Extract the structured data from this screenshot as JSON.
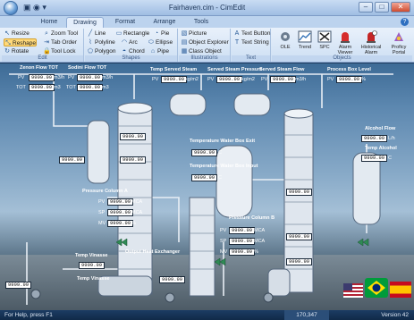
{
  "window": {
    "title": "Fairhaven.cim - CimEdit",
    "qat_glyphs": "▣ ◉ ▾",
    "btn_minimize": "–",
    "btn_maximize": "□",
    "btn_close": "✕"
  },
  "ribbon": {
    "tabs": [
      {
        "label": "Home"
      },
      {
        "label": "Drawing"
      },
      {
        "label": "Format"
      },
      {
        "label": "Arrange"
      },
      {
        "label": "Tools"
      }
    ],
    "help_glyph": "?",
    "edit_group": {
      "label": "Edit",
      "items": [
        {
          "label": "Resize",
          "icon": "resize-icon",
          "glyph": "↖"
        },
        {
          "label": "Zoom Tool",
          "icon": "zoom-icon",
          "glyph": "⌕"
        },
        {
          "label": "Reshape",
          "icon": "reshape-icon",
          "glyph": "⤡"
        },
        {
          "label": "Tab Order",
          "icon": "tab-order-icon",
          "glyph": "⇥"
        },
        {
          "label": "Rotate",
          "icon": "rotate-icon",
          "glyph": "↻"
        },
        {
          "label": "Tool Lock",
          "icon": "lock-icon",
          "glyph": "🔒"
        }
      ]
    },
    "shapes_group": {
      "label": "Shapes",
      "items": [
        {
          "label": "Line",
          "icon": "line-icon",
          "glyph": "╱"
        },
        {
          "label": "Rectangle",
          "icon": "rectangle-icon",
          "glyph": "▭"
        },
        {
          "label": "Pie",
          "icon": "pie-icon",
          "glyph": "◔"
        },
        {
          "label": "Polyline",
          "icon": "polyline-icon",
          "glyph": "⌇"
        },
        {
          "label": "Arc",
          "icon": "arc-icon",
          "glyph": "◠"
        },
        {
          "label": "Ellipse",
          "icon": "ellipse-icon",
          "glyph": "⬭"
        },
        {
          "label": "Polygon",
          "icon": "polygon-icon",
          "glyph": "⬠"
        },
        {
          "label": "Chord",
          "icon": "chord-icon",
          "glyph": "◓"
        },
        {
          "label": "Pipe",
          "icon": "pipe-icon",
          "glyph": "⌂"
        }
      ]
    },
    "illustrations_group": {
      "label": "Illustrations",
      "items": [
        {
          "label": "Picture",
          "icon": "picture-icon",
          "glyph": "▧"
        },
        {
          "label": "Object Explorer",
          "icon": "object-explorer-icon",
          "glyph": "▤"
        },
        {
          "label": "Class Object",
          "icon": "class-object-icon",
          "glyph": "▦"
        }
      ]
    },
    "text_group": {
      "label": "Text",
      "items": [
        {
          "label": "Text Button",
          "icon": "text-button-icon",
          "glyph": "A"
        },
        {
          "label": "Text String",
          "icon": "text-string-icon",
          "glyph": "T"
        }
      ]
    },
    "objects_group": {
      "label": "Objects",
      "buttons": [
        {
          "label": "OLE",
          "icon": "ole-icon"
        },
        {
          "label": "Trend",
          "icon": "trend-icon"
        },
        {
          "label": "SPC",
          "icon": "spc-icon"
        },
        {
          "label": "Alarm Viewer",
          "icon": "alarm-viewer-icon"
        },
        {
          "label": "Historical Alarm Viewer",
          "icon": "historical-alarm-icon"
        },
        {
          "label": "Proficy Portal",
          "icon": "proficy-portal-icon"
        }
      ]
    }
  },
  "canvas": {
    "top_panels": [
      {
        "title": "Zenon Flow TOT",
        "rows": [
          {
            "k": "PV",
            "v": "9999.99",
            "u": "m3/h"
          },
          {
            "k": "TOT",
            "v": "9999.99",
            "u": "m3"
          }
        ]
      },
      {
        "title": "Sodini Flow TOT",
        "rows": [
          {
            "k": "PV",
            "v": "9999.99",
            "u": "m3/h"
          },
          {
            "k": "TOT",
            "v": "9999.99",
            "u": "m3"
          }
        ]
      },
      {
        "title": "Temp Served Steam",
        "rows": [
          {
            "k": "PV",
            "v": "9999.99",
            "u": "kg/m2"
          }
        ]
      },
      {
        "title": "Served Steam Pressure",
        "rows": [
          {
            "k": "PV",
            "v": "9999.99",
            "u": "kg/m2"
          }
        ]
      },
      {
        "title": "Served Steam Flow",
        "rows": [
          {
            "k": "PV",
            "v": "9999.99",
            "u": "m3/h"
          }
        ]
      },
      {
        "title": "Process Box Level",
        "rows": [
          {
            "k": "PV",
            "v": "9999.99",
            "u": "%"
          }
        ]
      }
    ],
    "water_box": {
      "exit_label": "Temperature Water Box Exit",
      "exit_value": "9999.99",
      "inlet_label": "Temperature Water Box Input",
      "inlet_value": "9999.99",
      "unit": "C"
    },
    "pressure_a": {
      "title": "Pressure Column A",
      "rows": [
        {
          "k": "PV",
          "v": "9999.99",
          "u": "MCA"
        },
        {
          "k": "SP",
          "v": "9999.99",
          "u": "MCA"
        },
        {
          "k": "MV",
          "v": "9999.99",
          "u": "%"
        }
      ]
    },
    "pressure_b": {
      "title": "Pressure Column B",
      "rows": [
        {
          "k": "PV",
          "v": "9999.99",
          "u": "MCA"
        },
        {
          "k": "SP",
          "v": "9999.99",
          "u": "MCA"
        },
        {
          "k": "MV",
          "v": "9999.99",
          "u": "%"
        }
      ]
    },
    "alcohol": {
      "flow_label": "Alcohol Flow",
      "flow_value": "9999.99",
      "flow_unit": "L/h",
      "temp_label": "Temp Alcohol",
      "temp_value": "9999.99",
      "temp_unit": "C"
    },
    "small_values": [
      "9999.99",
      "9999.99",
      "9999.99",
      "9999.99",
      "9999.99",
      "9999.99",
      "9999.99",
      "9999.99"
    ],
    "bottom_labels": {
      "temp_a": "Temp Vinasse",
      "exchanger": "Output Heat Exchanger",
      "temp_b": "Temp Vinasse",
      "left_val": "9999.99"
    },
    "flags": [
      {
        "name": "usa-flag-icon"
      },
      {
        "name": "brazil-flag-icon"
      },
      {
        "name": "spain-flag-icon"
      }
    ]
  },
  "statusbar": {
    "help": "For Help, press F1",
    "coords": "170,347",
    "version": "Version 42"
  }
}
